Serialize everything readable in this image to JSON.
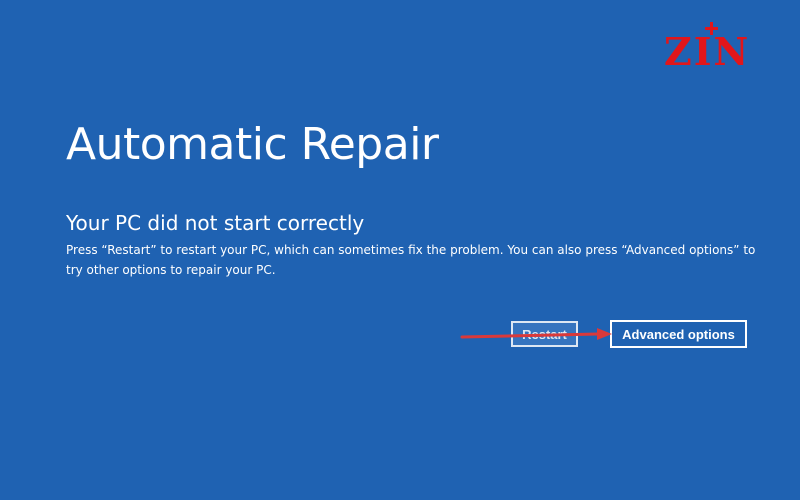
{
  "logo": {
    "text": "ZIN",
    "color": "#e1161b"
  },
  "screen": {
    "background": "#1f62b2",
    "title": "Automatic Repair",
    "subtitle": "Your PC did not start correctly",
    "description": "Press “Restart” to restart your PC, which can sometimes fix the problem. You can also press “Advanced options” to try other options to repair your PC."
  },
  "buttons": {
    "restart_label": "Restart",
    "advanced_label": "Advanced options"
  },
  "annotation": {
    "arrow_color": "#d9393a",
    "arrow_target": "advanced-options-button"
  }
}
